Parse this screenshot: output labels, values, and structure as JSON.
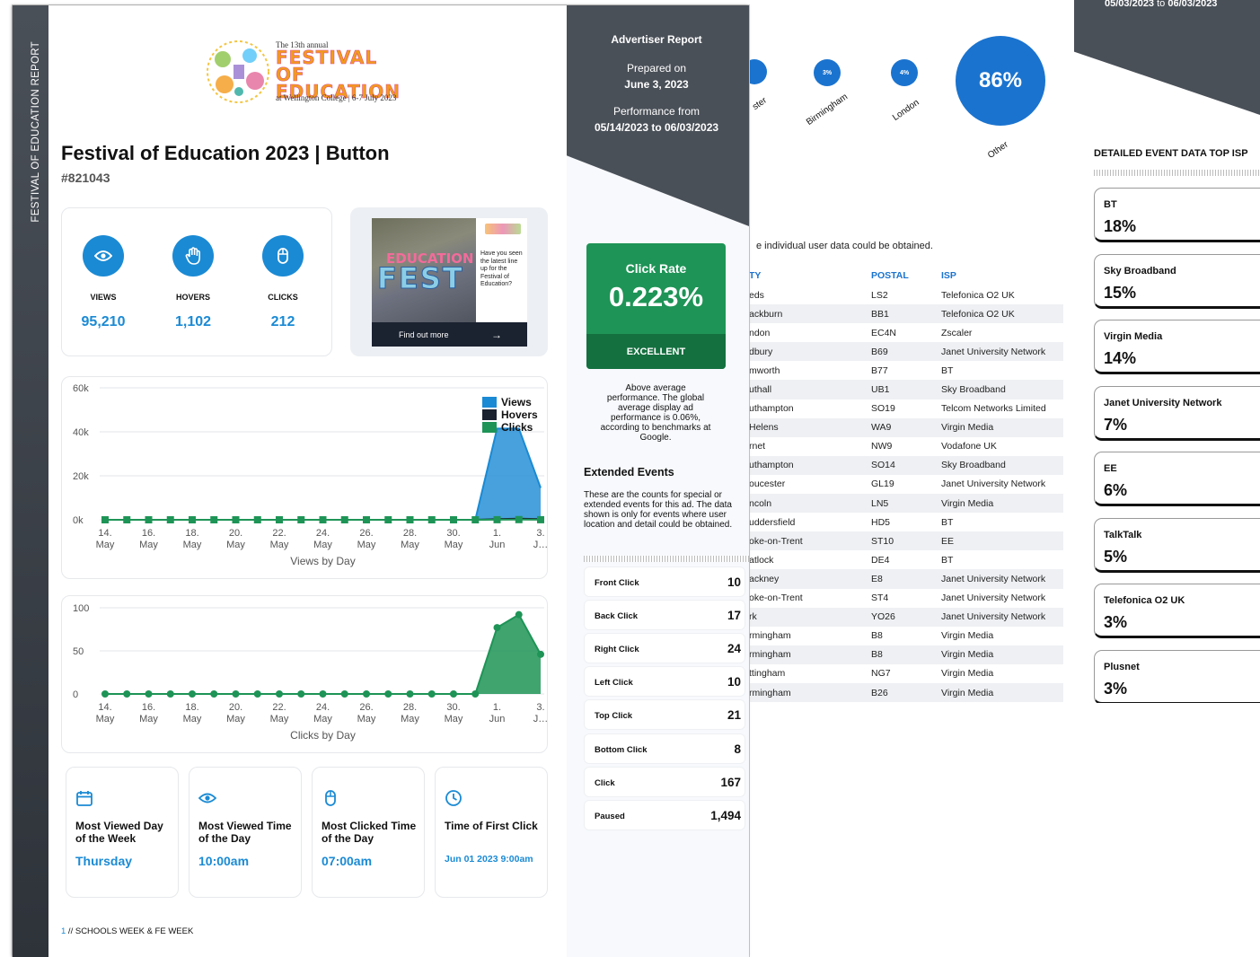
{
  "page2": {
    "bubbles": [
      {
        "label": "ster",
        "value": ""
      },
      {
        "label": "Birmingham",
        "value": "3%"
      },
      {
        "label": "London",
        "value": "4%"
      },
      {
        "label": "Other",
        "value": "86%"
      }
    ],
    "note": "e individual user data could be obtained.",
    "table": {
      "headers": [
        "TY",
        "POSTAL",
        "ISP"
      ],
      "rows": [
        [
          "eds",
          "LS2",
          "Telefonica O2 UK"
        ],
        [
          "ackburn",
          "BB1",
          "Telefonica O2 UK"
        ],
        [
          "ndon",
          "EC4N",
          "Zscaler"
        ],
        [
          "dbury",
          "B69",
          "Janet University Network"
        ],
        [
          "mworth",
          "B77",
          "BT"
        ],
        [
          "uthall",
          "UB1",
          "Sky Broadband"
        ],
        [
          "uthampton",
          "SO19",
          "Telcom Networks Limited"
        ],
        [
          " Helens",
          "WA9",
          "Virgin Media"
        ],
        [
          "rnet",
          "NW9",
          "Vodafone UK"
        ],
        [
          "uthampton",
          "SO14",
          "Sky Broadband"
        ],
        [
          "oucester",
          "GL19",
          "Janet University Network"
        ],
        [
          "ncoln",
          "LN5",
          "Virgin Media"
        ],
        [
          "uddersfield",
          "HD5",
          "BT"
        ],
        [
          "oke-on-Trent",
          "ST10",
          "EE"
        ],
        [
          "atlock",
          "DE4",
          "BT"
        ],
        [
          "ackney",
          "E8",
          "Janet University Network"
        ],
        [
          "oke-on-Trent",
          "ST4",
          "Janet University Network"
        ],
        [
          "rk",
          "YO26",
          "Janet University Network"
        ],
        [
          "rmingham",
          "B8",
          "Virgin Media"
        ],
        [
          "rmingham",
          "B8",
          "Virgin Media"
        ],
        [
          "ttingham",
          "NG7",
          "Virgin Media"
        ],
        [
          "rmingham",
          "B26",
          "Virgin Media"
        ]
      ]
    }
  },
  "page3": {
    "date_range_start": "05/03/2023",
    "date_range_word": "to",
    "date_range_end": "06/03/2023",
    "isp_title": "DETAILED EVENT DATA TOP ISP",
    "isps": [
      {
        "name": "BT",
        "pct": "18%"
      },
      {
        "name": "Sky Broadband",
        "pct": "15%"
      },
      {
        "name": "Virgin Media",
        "pct": "14%"
      },
      {
        "name": "Janet University Network",
        "pct": "7%"
      },
      {
        "name": "EE",
        "pct": "6%"
      },
      {
        "name": "TalkTalk",
        "pct": "5%"
      },
      {
        "name": "Telefonica O2 UK",
        "pct": "3%"
      },
      {
        "name": "Plusnet",
        "pct": "3%"
      }
    ]
  },
  "page1": {
    "spine_text": "FESTIVAL OF EDUCATION REPORT",
    "logo": {
      "small": "The 13th annual",
      "big": "FESTIVAL OF EDUCATION",
      "sub": "at Wellington College | 6-7 July 2023"
    },
    "title": "Festival of Education 2023 | Button",
    "id": "#821043",
    "stats": [
      {
        "label": "VIEWS",
        "value": "95,210",
        "icon": "eye-icon"
      },
      {
        "label": "HOVERS",
        "value": "1,102",
        "icon": "hand-icon"
      },
      {
        "label": "CLICKS",
        "value": "212",
        "icon": "mouse-icon"
      }
    ],
    "ad": {
      "image_text_1": "EDUCATION",
      "image_text_2": "FEST",
      "copy": "Have you seen the latest line up for the Festival of Education?",
      "cta": "Find out more",
      "cta_arrow": "→"
    },
    "kpis": [
      {
        "icon": "calendar-icon",
        "title": "Most Viewed Day of the Week",
        "value": "Thursday"
      },
      {
        "icon": "eye-icon",
        "title": "Most Viewed Time of the Day",
        "value": "10:00am"
      },
      {
        "icon": "mouse-icon",
        "title": "Most Clicked Time of the Day",
        "value": "07:00am"
      },
      {
        "icon": "clock-icon",
        "title": "Time of First Click",
        "value": "Jun 01 2023 9:00am"
      }
    ],
    "footer_page": "1",
    "footer_text": " // SCHOOLS WEEK & FE WEEK",
    "sidebar": {
      "report_title": "Advertiser Report",
      "prepared_label": "Prepared on",
      "prepared_date": "June 3, 2023",
      "perf_label": "Performance from",
      "perf_range": "05/14/2023 to 06/03/2023",
      "click_rate_label": "Click Rate",
      "click_rate_value": "0.223%",
      "click_rate_badge": "EXCELLENT",
      "click_rate_note": "Above average performance. The global average display ad performance is 0.06%, according to benchmarks at Google.",
      "extended_title": "Extended Events",
      "extended_desc": "These are the counts for special or extended events for this ad. The data shown is only for events where user location and detail could be obtained.",
      "events": [
        {
          "name": "Front Click",
          "value": "10"
        },
        {
          "name": "Back Click",
          "value": "17"
        },
        {
          "name": "Right Click",
          "value": "24"
        },
        {
          "name": "Left Click",
          "value": "10"
        },
        {
          "name": "Top Click",
          "value": "21"
        },
        {
          "name": "Bottom Click",
          "value": "8"
        },
        {
          "name": "Click",
          "value": "167"
        },
        {
          "name": "Paused",
          "value": "1,494"
        }
      ]
    }
  },
  "colors": {
    "accent": "#1a8ad4",
    "views": "#1a8ad4",
    "hovers": "#1b2230",
    "clicks": "#1e9456",
    "sidebar_dark": "#4a5058"
  },
  "chart_data": [
    {
      "type": "area",
      "xlabel": "Views by Day",
      "ylabel": "",
      "ylim": [
        0,
        60000
      ],
      "y_ticks": [
        "0k",
        "20k",
        "40k",
        "60k"
      ],
      "x_ticks": [
        "14. May",
        "16. May",
        "18. May",
        "20. May",
        "22. May",
        "24. May",
        "26. May",
        "28. May",
        "30. May",
        "1. Jun",
        "3. J…"
      ],
      "x": [
        "14 May",
        "15 May",
        "16 May",
        "17 May",
        "18 May",
        "19 May",
        "20 May",
        "21 May",
        "22 May",
        "23 May",
        "24 May",
        "25 May",
        "26 May",
        "27 May",
        "28 May",
        "29 May",
        "30 May",
        "31 May",
        "1 Jun",
        "2 Jun",
        "3 Jun"
      ],
      "legend": "top-right",
      "series": [
        {
          "name": "Views",
          "values": [
            0,
            0,
            0,
            0,
            0,
            0,
            0,
            0,
            0,
            0,
            0,
            0,
            0,
            0,
            0,
            0,
            0,
            0,
            41500,
            41500,
            14500
          ]
        },
        {
          "name": "Hovers",
          "values": [
            0,
            0,
            0,
            0,
            0,
            0,
            0,
            0,
            0,
            0,
            0,
            0,
            0,
            0,
            0,
            0,
            0,
            0,
            300,
            500,
            300
          ]
        },
        {
          "name": "Clicks",
          "values": [
            0,
            0,
            0,
            0,
            0,
            0,
            0,
            0,
            0,
            0,
            0,
            0,
            0,
            0,
            0,
            0,
            0,
            0,
            50,
            90,
            40
          ]
        }
      ]
    },
    {
      "type": "area",
      "xlabel": "Clicks by Day",
      "ylabel": "",
      "ylim": [
        0,
        100
      ],
      "y_ticks": [
        "0",
        "50",
        "100"
      ],
      "x_ticks": [
        "14. May",
        "16. May",
        "18. May",
        "20. May",
        "22. May",
        "24. May",
        "26. May",
        "28. May",
        "30. May",
        "1. Jun",
        "3. J…"
      ],
      "x": [
        "14 May",
        "15 May",
        "16 May",
        "17 May",
        "18 May",
        "19 May",
        "20 May",
        "21 May",
        "22 May",
        "23 May",
        "24 May",
        "25 May",
        "26 May",
        "27 May",
        "28 May",
        "29 May",
        "30 May",
        "31 May",
        "1 Jun",
        "2 Jun",
        "3 Jun"
      ],
      "series": [
        {
          "name": "Clicks",
          "values": [
            0,
            0,
            0,
            0,
            0,
            0,
            0,
            0,
            0,
            0,
            0,
            0,
            0,
            0,
            0,
            0,
            0,
            0,
            77,
            92,
            46
          ]
        }
      ]
    }
  ]
}
